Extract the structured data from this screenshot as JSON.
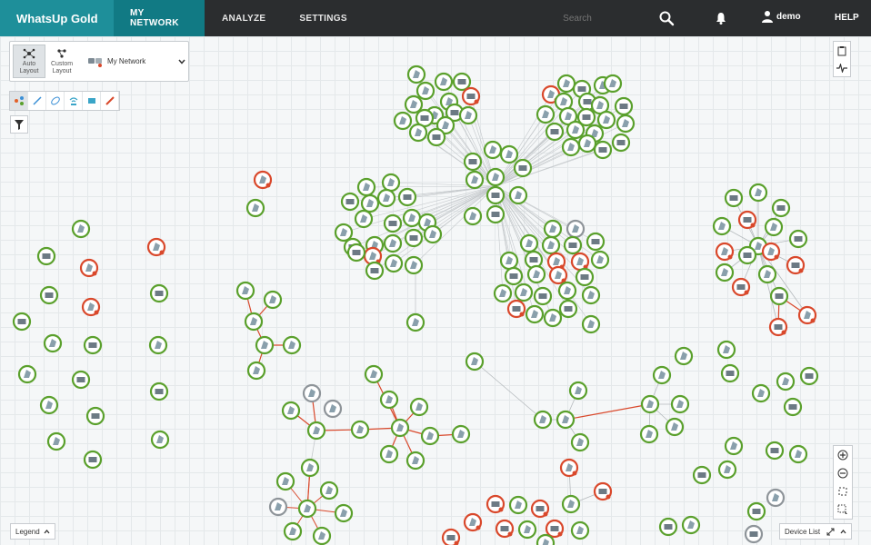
{
  "app": {
    "logo_text": "WhatsUp Gold",
    "nav": {
      "my_network": "MY NETWORK",
      "analyze": "ANALYZE",
      "settings": "SETTINGS"
    },
    "search_placeholder": "Search",
    "user_name": "demo",
    "help": "HELP",
    "colors": {
      "topbar": "#2b2d2f",
      "brand": "#1e8f9a",
      "active_nav": "#117a84",
      "node_up": "#5aa02c",
      "node_down": "#d9482b",
      "node_unknown": "#8e9499"
    }
  },
  "layout_panel": {
    "auto_layout": "Auto\nLayout",
    "auto_layout_line1": "Auto",
    "auto_layout_line2": "Layout",
    "custom_layout_line1": "Custom",
    "custom_layout_line2": "Layout",
    "network_name": "My Network"
  },
  "toolbar": {
    "tools": [
      "layout-tool-icon",
      "link-tool-icon",
      "discover-tool-icon",
      "wireless-tool-icon",
      "device-tool-icon",
      "pencil-tool-icon"
    ]
  },
  "legend_label": "Legend",
  "device_list_label": "Device List"
}
